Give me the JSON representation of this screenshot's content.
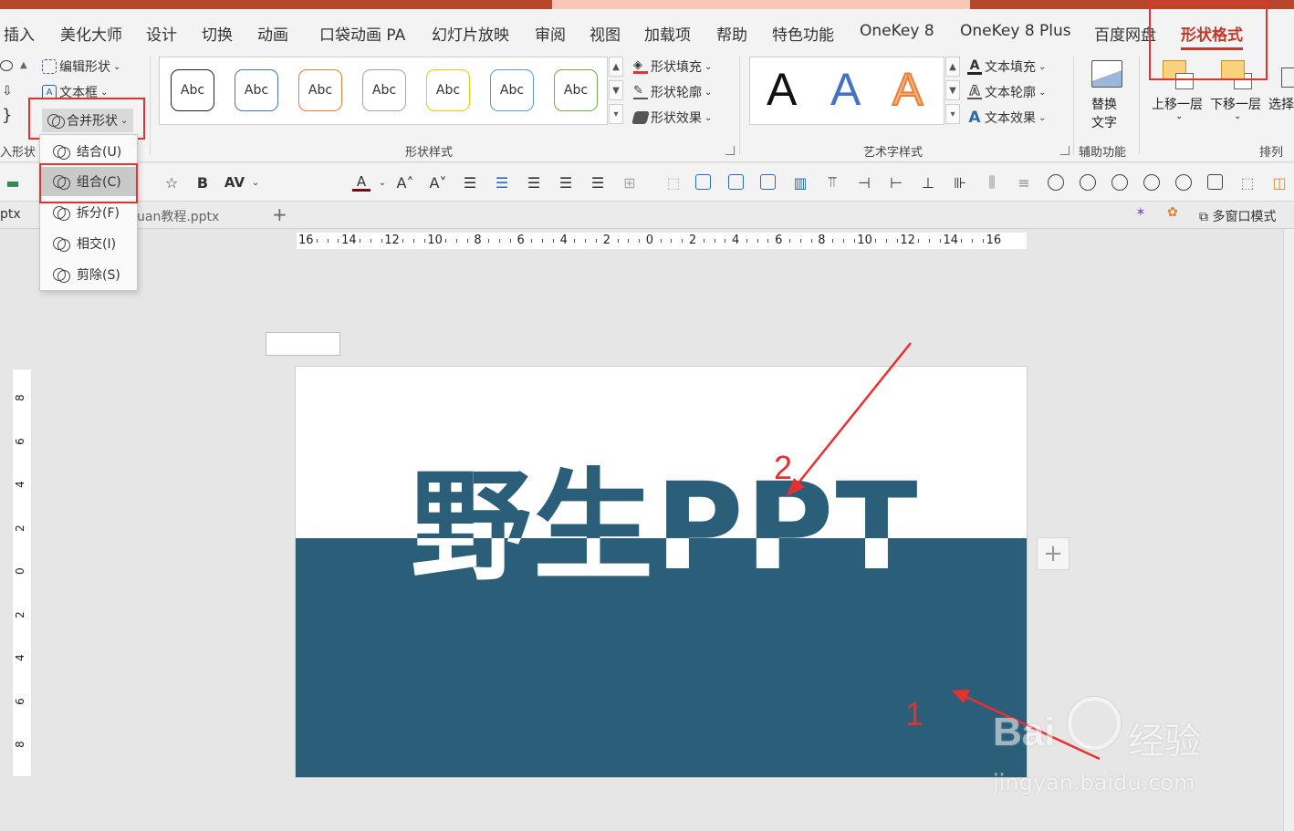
{
  "ribbon_tabs": [
    "插入",
    "美化大师",
    "设计",
    "切换",
    "动画",
    "口袋动画 PA",
    "幻灯片放映",
    "审阅",
    "视图",
    "加载项",
    "帮助",
    "特色功能",
    "OneKey 8",
    "OneKey 8 Plus",
    "百度网盘",
    "形状格式"
  ],
  "active_tab": "形状格式",
  "insert_shapes": {
    "edit_shape": "编辑形状",
    "text_box": "文本框",
    "merge_shapes": "合并形状",
    "group_label": "入形状"
  },
  "shape_styles": {
    "swatch_text": "Abc",
    "swatches": [
      {
        "color": "#222222"
      },
      {
        "color": "#4472c4"
      },
      {
        "color": "#ed7d31"
      },
      {
        "color": "#a5a5a5"
      },
      {
        "color": "#ffc000"
      },
      {
        "color": "#5b9bd5"
      },
      {
        "color": "#70ad47"
      }
    ],
    "fill": "形状填充",
    "outline": "形状轮廓",
    "effects": "形状效果",
    "group_label": "形状样式"
  },
  "wordart": {
    "letters": [
      {
        "char": "A",
        "color": "#111111"
      },
      {
        "char": "A",
        "color": "#4472c4"
      },
      {
        "char": "A",
        "color": "#f4b183"
      }
    ],
    "fill": "文本填充",
    "outline": "文本轮廓",
    "effects": "文本效果",
    "group_label": "艺术字样式"
  },
  "accessibility": {
    "alt_text_line1": "替换",
    "alt_text_line2": "文字",
    "group_label": "辅助功能"
  },
  "arrange": {
    "bring_forward": "上移一层",
    "send_backward": "下移一层",
    "select": "选择",
    "group_label": "排列"
  },
  "toolbar2": {
    "bold": "B",
    "spacing": "AV",
    "font_size_value": ""
  },
  "file_tabs": {
    "tab1": "ptx",
    "tab2": "uan教程.pptx",
    "add": "+",
    "multi_window": "多窗口模式"
  },
  "merge_menu": {
    "items": [
      "结合(U)",
      "组合(C)",
      "拆分(F)",
      "相交(I)",
      "剪除(S)"
    ],
    "highlighted": "组合(C)"
  },
  "ruler_h": [
    "16",
    "14",
    "12",
    "10",
    "8",
    "6",
    "4",
    "2",
    "0",
    "2",
    "4",
    "6",
    "8",
    "10",
    "12",
    "14",
    "16"
  ],
  "ruler_v": [
    "8",
    "6",
    "4",
    "2",
    "0",
    "2",
    "4",
    "6",
    "8"
  ],
  "slide": {
    "headline": "野生PPT",
    "band_color": "#2b5e78"
  },
  "annotations": {
    "label1": "1",
    "label2": "2"
  },
  "watermark": {
    "brand": "Bai",
    "cn": "经验",
    "url": "jingyan.baidu.com"
  },
  "colors": {
    "accent": "#c0392b",
    "highlight_box": "#e8302f"
  }
}
